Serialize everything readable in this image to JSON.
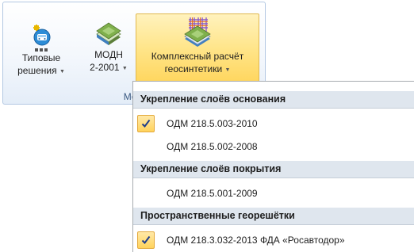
{
  "ribbon": {
    "group_caption": "Мето",
    "buttons": {
      "typical": {
        "line1": "Типовые",
        "line2": "решения",
        "icon": "typical-solutions-icon"
      },
      "modn": {
        "line1": "МОДН",
        "line2": "2-2001",
        "icon": "book-icon"
      },
      "complex": {
        "line1": "Комплексный расчёт",
        "line2": "геосинтетики",
        "icon": "grid-book-icon"
      }
    }
  },
  "dropdown": {
    "sections": [
      {
        "header": "Укрепление слоёв основания",
        "items": [
          {
            "label": "ОДМ 218.5.003-2010",
            "checked": true
          },
          {
            "label": "ОДМ 218.5.002-2008",
            "checked": false
          }
        ]
      },
      {
        "header": "Укрепление слоёв покрытия",
        "items": [
          {
            "label": "ОДМ 218.5.001-2009",
            "checked": false
          }
        ]
      },
      {
        "header": "Пространственные георешётки",
        "items": [
          {
            "label": "ОДМ 218.3.032-2013 ФДА «Росавтодор»",
            "checked": true
          }
        ]
      }
    ]
  },
  "colors": {
    "highlight": "#ffd65e",
    "menu_header_bg": "#dfe6ee",
    "check_border": "#e3a93b"
  }
}
